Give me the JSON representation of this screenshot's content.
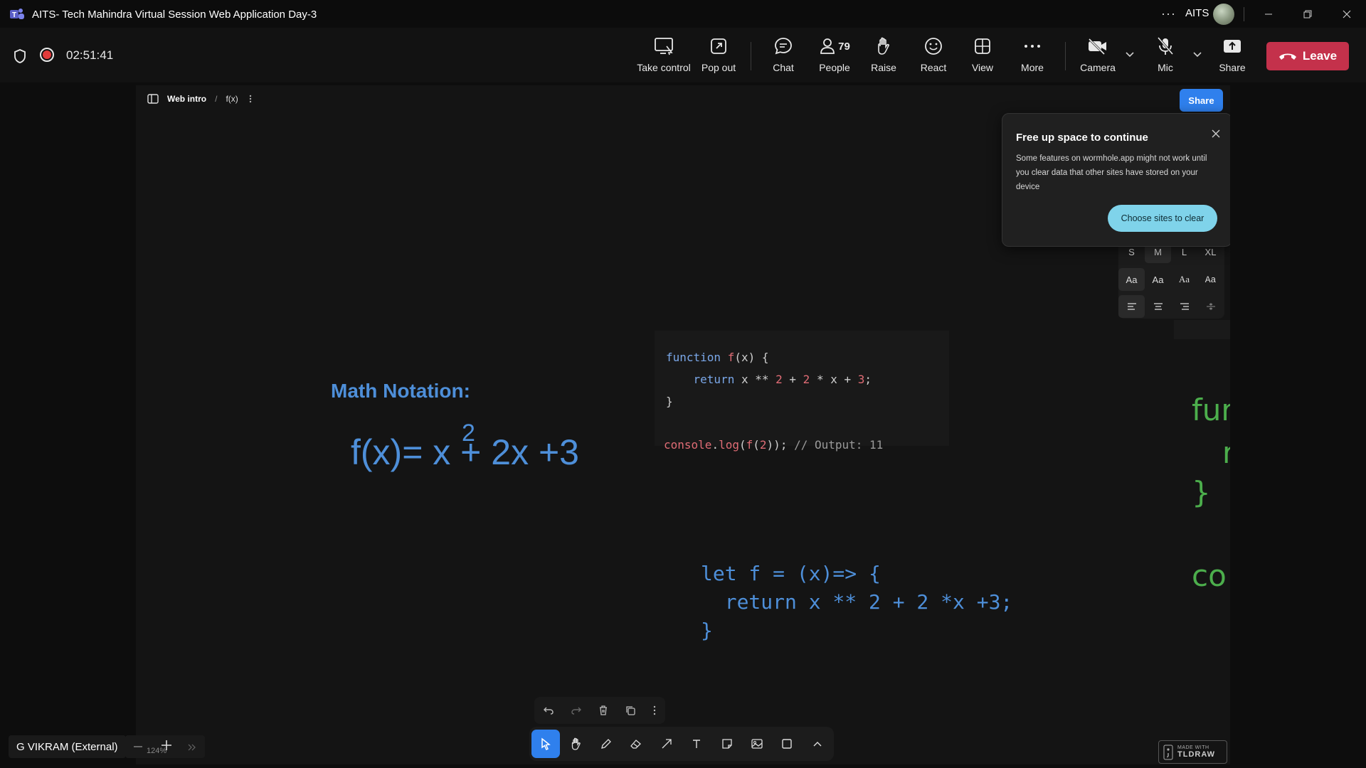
{
  "window": {
    "title": "AITS- Tech Mahindra Virtual Session Web Application Day-3",
    "org": "AITS",
    "more_label": "···"
  },
  "meeting": {
    "timer": "02:51:41",
    "tools": {
      "take_control": "Take control",
      "pop_out": "Pop out",
      "chat": "Chat",
      "people": "People",
      "people_count": "79",
      "raise": "Raise",
      "react": "React",
      "view": "View",
      "more": "More",
      "camera": "Camera",
      "mic": "Mic",
      "share": "Share"
    },
    "leave_label": "Leave"
  },
  "canvas": {
    "breadcrumb": {
      "page": "Web intro",
      "item": "f(x)"
    },
    "share_label": "Share",
    "math_title": "Math Notation:",
    "formula": "f(x)= x  + 2x +3",
    "superscript": "2",
    "code_lines": [
      "function f(x) {",
      "    return x ** 2 + 2 * x + 3;",
      "}",
      "",
      "console.log(f(2)); // Output: 11"
    ],
    "handwritten": [
      "let f = (x)=> {",
      "  return x ** 2 + 2 *x +3;",
      "}"
    ],
    "green_fragments": [
      "fur",
      "r",
      "}",
      "co"
    ],
    "text_style": {
      "sizes": [
        "S",
        "M",
        "L",
        "XL"
      ],
      "fonts": [
        "Aa",
        "Aa",
        "Aa",
        "Aa"
      ],
      "selected_size": "M"
    },
    "toast": {
      "title": "Free up space to continue",
      "body": "Some features on wormhole.app might not work until you clear data that other sites have stored on your device",
      "button": "Choose sites to clear"
    },
    "zoom_level": "124%",
    "made_with": {
      "line1": "MADE WITH",
      "line2": "TLDRAW"
    }
  },
  "participant": {
    "name": "G VIKRAM (External)"
  },
  "colors": {
    "leave": "#c4314b",
    "share_blue": "#2f80ed",
    "math_blue": "#4e8fd9",
    "code_green": "#4cae4c",
    "toast_button": "#7fd3ea"
  }
}
